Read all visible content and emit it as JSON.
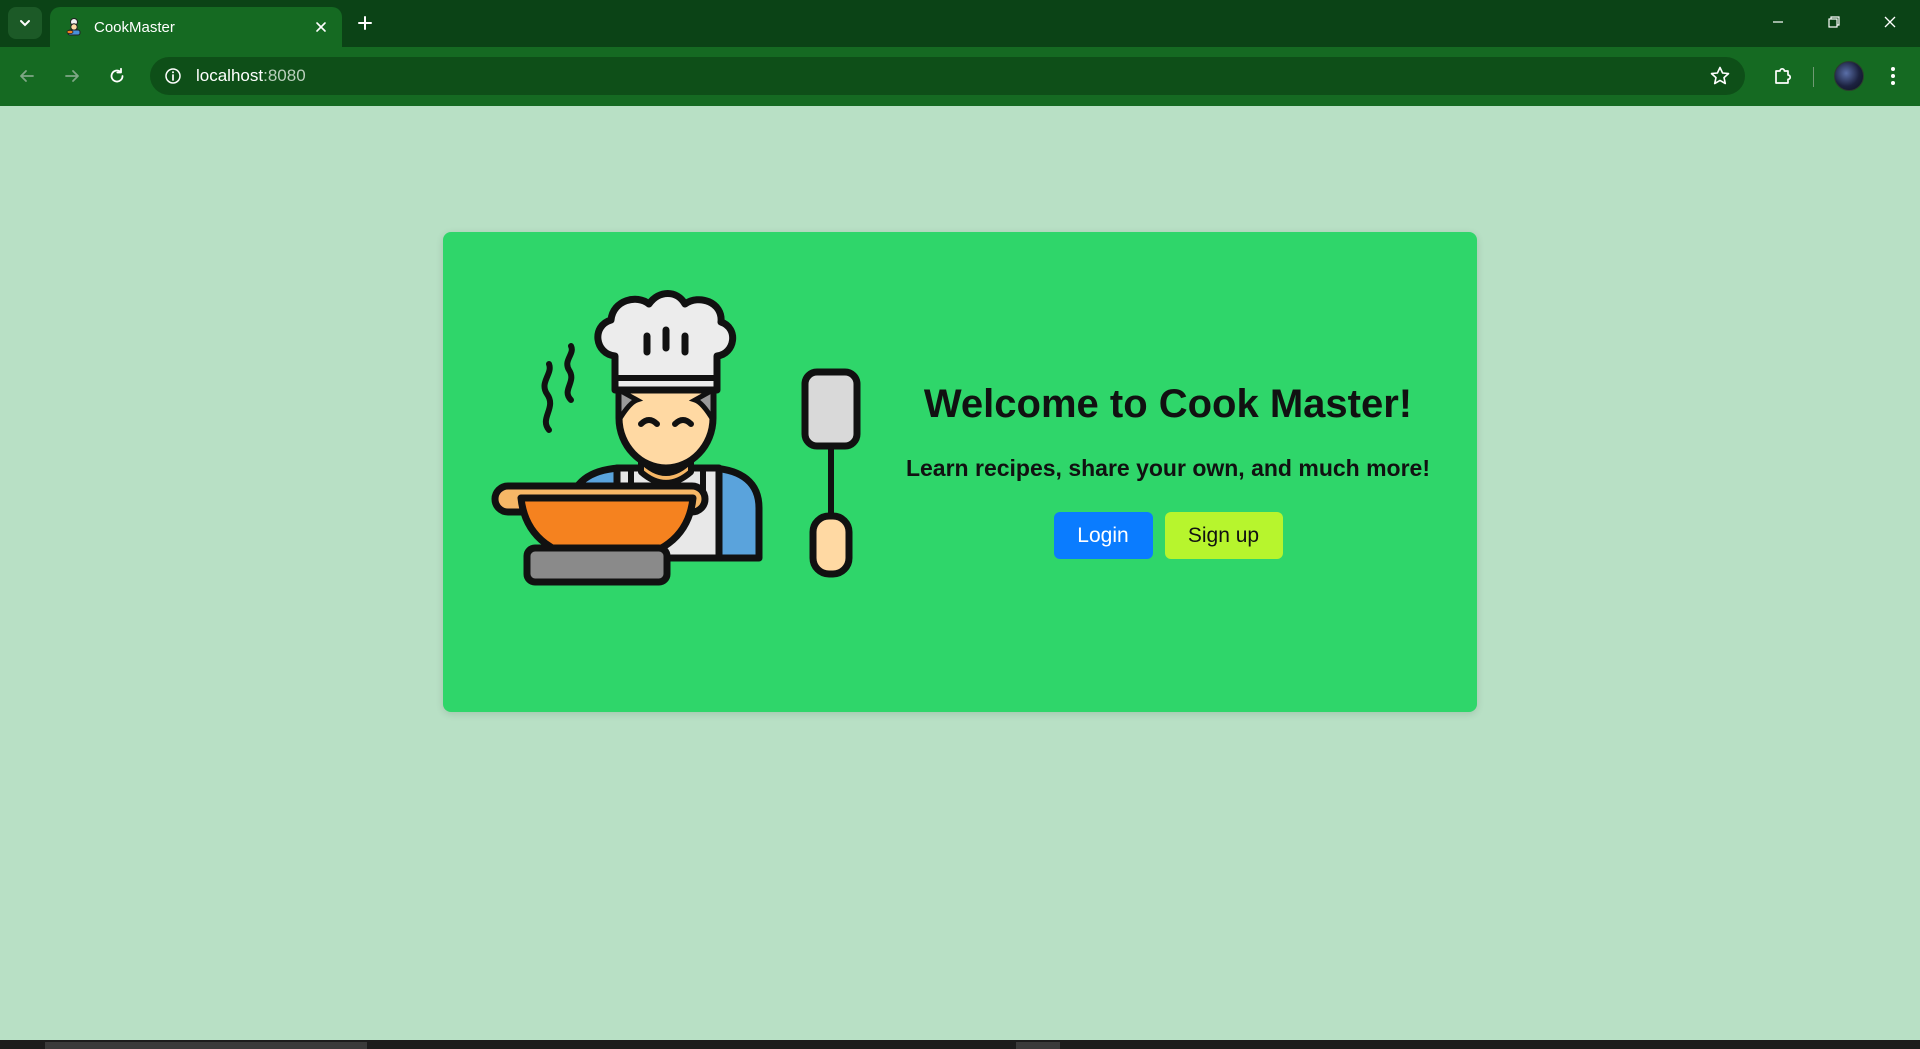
{
  "browser": {
    "tab_title": "CookMaster",
    "url_host": "localhost",
    "url_port": ":8080"
  },
  "colors": {
    "page_background": "#b8e0c5",
    "card_background": "#2fd66a",
    "login_button": "#0a7cff",
    "signup_button": "#b7f52d",
    "browser_frame": "#0b4316"
  },
  "icons": {
    "tab_search": "chevron-down-icon",
    "favicon": "chef-icon",
    "tab_close": "close-icon",
    "new_tab": "plus-icon",
    "back": "arrow-left-icon",
    "forward": "arrow-right-icon",
    "reload": "reload-icon",
    "site_info": "info-icon",
    "bookmark": "star-icon",
    "extensions": "puzzle-icon",
    "menu": "kebab-menu-icon",
    "hero": "chef-cooking-illustration"
  },
  "hero": {
    "title": "Welcome to Cook Master!",
    "subtitle": "Learn recipes, share your own, and much more!",
    "login_label": "Login",
    "signup_label": "Sign up"
  }
}
